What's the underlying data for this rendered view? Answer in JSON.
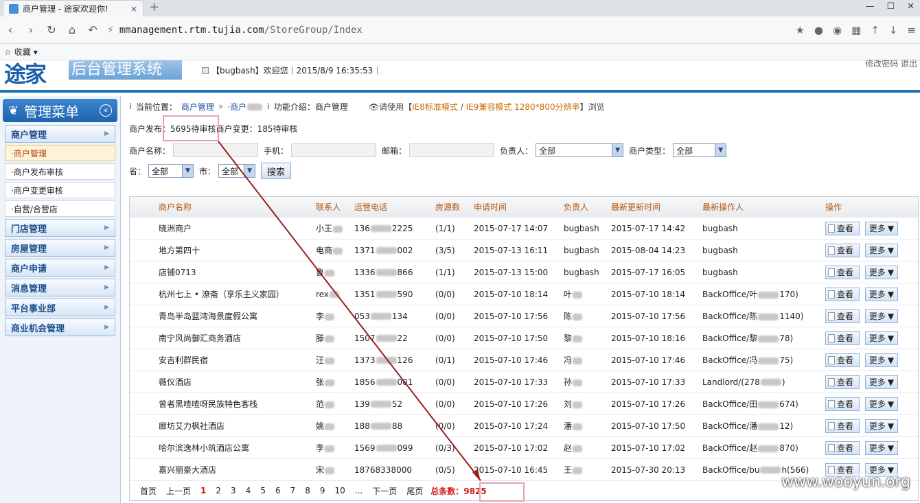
{
  "browser": {
    "tab_title": "商户管理 - 途家欢迎你!",
    "tab_close": "×",
    "new_tab": "+",
    "url_host": "mmanagement.rtm.tujia.com",
    "url_path": "/StoreGroup/Index",
    "favorites": "收藏"
  },
  "header": {
    "logo": "途家",
    "system_name": "后台管理系统",
    "welcome": "【bugbash】欢迎您｜2015/8/9 16:35:53｜",
    "top_links": "修改密码  退出"
  },
  "sidebar": {
    "title": "管理菜单",
    "groups_top": [
      {
        "label": "商户管理"
      }
    ],
    "subs": [
      {
        "label": "·商户管理",
        "active": true
      },
      {
        "label": "·商户发布审核",
        "active": false
      },
      {
        "label": "·商户变更审核",
        "active": false
      },
      {
        "label": "·自营/合营店",
        "active": false
      }
    ],
    "groups": [
      {
        "label": "门店管理"
      },
      {
        "label": "房屋管理"
      },
      {
        "label": "商户申请"
      },
      {
        "label": "消息管理"
      },
      {
        "label": "平台事业部"
      },
      {
        "label": "商业机会管理"
      }
    ]
  },
  "breadcrumb": {
    "location_label": "当前位置：",
    "path1": "商户管理",
    "sep": "»",
    "path2": "·商户",
    "intro": "功能介绍：商户管理",
    "hint_prefix": "请使用【",
    "hint_mode1": "IE8标准模式",
    "hint_slash": " / ",
    "hint_mode2": "IE9兼容模式",
    "hint_res": " 1280*800分辨率",
    "hint_suffix": "】浏览"
  },
  "stats": {
    "publish_label": "商户发布：",
    "publish_value": "5695待审核",
    "change_label": " 商户变更：",
    "change_value": "185待审核"
  },
  "filters": {
    "name_label": "商户名称：",
    "phone_label": "手机：",
    "email_label": "邮箱：",
    "owner_label": "负责人：",
    "owner_value": "全部",
    "type_label": "商户类型：",
    "type_value": "全部",
    "province_label": "省：",
    "province_value": "全部",
    "city_label": "市：",
    "city_value": "全部",
    "search_button": "搜索"
  },
  "table": {
    "headers": [
      "商户名称",
      "联系人",
      "运营电话",
      "房源数",
      "申请时间",
      "负责人",
      "最新更新时间",
      "最新操作人",
      "操作"
    ],
    "view_label": "查看",
    "more_label": "更多",
    "rows": [
      {
        "name": "晓洲商户",
        "contact": "小王",
        "phone_a": "136",
        "phone_b": "2225",
        "rooms": "(1/1)",
        "applied": "2015-07-17 14:07",
        "owner": "bugbash",
        "updated": "2015-07-17 14:42",
        "operator_a": "bugbash",
        "operator_b": ""
      },
      {
        "name": "地方第四十",
        "contact": "电商",
        "phone_a": "1371",
        "phone_b": "002",
        "rooms": "(3/5)",
        "applied": "2015-07-13 16:11",
        "owner": "bugbash",
        "updated": "2015-08-04 14:23",
        "operator_a": "bugbash",
        "operator_b": ""
      },
      {
        "name": "店铺0713",
        "contact": "鲁",
        "phone_a": "1336",
        "phone_b": "866",
        "rooms": "(1/1)",
        "applied": "2015-07-13 15:00",
        "owner": "bugbash",
        "updated": "2015-07-17 16:05",
        "operator_a": "bugbash",
        "operator_b": ""
      },
      {
        "name": "杭州七上 • 潦斋（享乐主义家园）",
        "contact": "rex",
        "phone_a": "1351",
        "phone_b": "590",
        "rooms": "(0/0)",
        "applied": "2015-07-10 18:14",
        "owner": "叶",
        "updated": "2015-07-10 18:14",
        "operator_a": "BackOffice/叶",
        "operator_b": "170)"
      },
      {
        "name": "青岛半岛蓝湾海景度假公寓",
        "contact": "李",
        "phone_a": "053",
        "phone_b": "134",
        "rooms": "(0/0)",
        "applied": "2015-07-10 17:56",
        "owner": "陈",
        "updated": "2015-07-10 17:56",
        "operator_a": "BackOffice/陈",
        "operator_b": "1140)"
      },
      {
        "name": "南宁风尚御汇商务酒店",
        "contact": "滕",
        "phone_a": "1507",
        "phone_b": "22",
        "rooms": "(0/0)",
        "applied": "2015-07-10 17:50",
        "owner": "黎",
        "updated": "2015-07-10 18:16",
        "operator_a": "BackOffice/黎",
        "operator_b": "78)"
      },
      {
        "name": "安吉利群民宿",
        "contact": "汪",
        "phone_a": "1373",
        "phone_b": "126",
        "rooms": "(0/1)",
        "applied": "2015-07-10 17:46",
        "owner": "冯",
        "updated": "2015-07-10 17:46",
        "operator_a": "BackOffice/冯",
        "operator_b": "75)"
      },
      {
        "name": "薇仪酒店",
        "contact": "张",
        "phone_a": "1856",
        "phone_b": "001",
        "rooms": "(0/0)",
        "applied": "2015-07-10 17:33",
        "owner": "孙",
        "updated": "2015-07-10 17:33",
        "operator_a": "Landlord/(278",
        "operator_b": ")"
      },
      {
        "name": "曾者黑喳喳呀民族特色客栈",
        "contact": "范",
        "phone_a": "139",
        "phone_b": "52",
        "rooms": "(0/0)",
        "applied": "2015-07-10 17:26",
        "owner": "刘",
        "updated": "2015-07-10 17:26",
        "operator_a": "BackOffice/田",
        "operator_b": "674)"
      },
      {
        "name": "廊坊艾力枫社酒店",
        "contact": "姚",
        "phone_a": "188",
        "phone_b": "88",
        "rooms": "(0/0)",
        "applied": "2015-07-10 17:24",
        "owner": "潘",
        "updated": "2015-07-10 17:50",
        "operator_a": "BackOffice/潘",
        "operator_b": "12)"
      },
      {
        "name": "哈尔滨逸林小筑酒店公寓",
        "contact": "李",
        "phone_a": "1569",
        "phone_b": "099",
        "rooms": "(0/3)",
        "applied": "2015-07-10 17:02",
        "owner": "赵",
        "updated": "2015-07-10 17:02",
        "operator_a": "BackOffice/赵",
        "operator_b": "870)"
      },
      {
        "name": "嘉兴丽豪大酒店",
        "contact": "宋",
        "phone_a": "18768338000",
        "phone_b": "",
        "rooms": "(0/5)",
        "applied": "2015-07-10 16:45",
        "owner": "王",
        "updated": "2015-07-30 20:13",
        "operator_a": "BackOffice/bu",
        "operator_b": "h(566)"
      }
    ]
  },
  "pager": {
    "first": "首页",
    "prev": "上一页",
    "pages": [
      "1",
      "2",
      "3",
      "4",
      "5",
      "6",
      "7",
      "8",
      "9",
      "10",
      "..."
    ],
    "next": "下一页",
    "last": "尾页",
    "total": "总条数：9825"
  },
  "watermark": "www.wooyun.org",
  "colors": {
    "accent": "#1f6fb5",
    "header_text": "#b5570e",
    "current_page": "#d01818",
    "annotation": "#e8a0b8",
    "arrow": "#9b1c1c"
  }
}
